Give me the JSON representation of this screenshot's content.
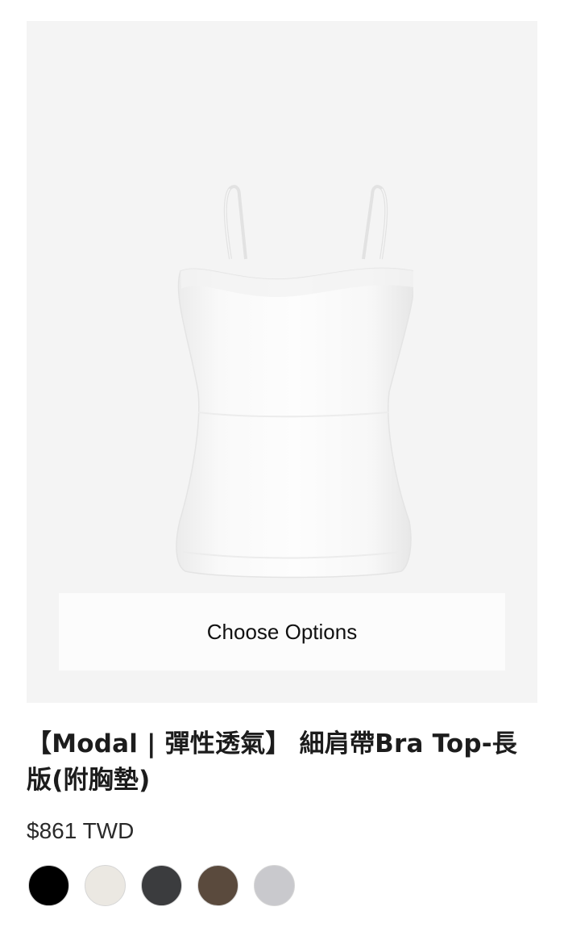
{
  "product": {
    "title": "【Modal | 彈性透氣】 細肩帶Bra Top-長版(附胸墊)",
    "price": "$861 TWD",
    "image_alt": "white camisole bra top",
    "choose_options_label": "Choose Options"
  },
  "swatches": [
    {
      "name": "black",
      "color": "#000000"
    },
    {
      "name": "ivory",
      "color": "#ebe8e2"
    },
    {
      "name": "charcoal",
      "color": "#3b3c3e"
    },
    {
      "name": "brown",
      "color": "#5a4a3d"
    },
    {
      "name": "light-gray",
      "color": "#c9c9cd"
    }
  ]
}
